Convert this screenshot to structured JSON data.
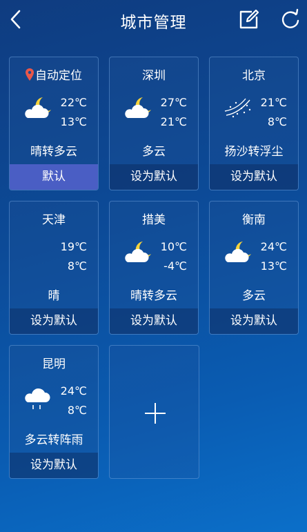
{
  "header": {
    "title": "城市管理"
  },
  "cities": [
    {
      "name": "自动定位",
      "hi": "22℃",
      "lo": "13℃",
      "desc": "晴转多云",
      "icon": "cloudy-moon-icon",
      "button": "默认",
      "is_default": true,
      "located": true
    },
    {
      "name": "深圳",
      "hi": "27℃",
      "lo": "21℃",
      "desc": "多云",
      "icon": "cloudy-moon-icon",
      "button": "设为默认",
      "is_default": false
    },
    {
      "name": "北京",
      "hi": "21℃",
      "lo": "8℃",
      "desc": "扬沙转浮尘",
      "icon": "sand-wind-icon",
      "button": "设为默认",
      "is_default": false
    },
    {
      "name": "天津",
      "hi": "19℃",
      "lo": "8℃",
      "desc": "晴",
      "icon": "moon-icon",
      "button": "设为默认",
      "is_default": false
    },
    {
      "name": "措美",
      "hi": "10℃",
      "lo": "-4℃",
      "desc": "晴转多云",
      "icon": "cloudy-moon-icon",
      "button": "设为默认",
      "is_default": false
    },
    {
      "name": "衡南",
      "hi": "24℃",
      "lo": "13℃",
      "desc": "多云",
      "icon": "cloudy-moon-icon",
      "button": "设为默认",
      "is_default": false
    },
    {
      "name": "昆明",
      "hi": "24℃",
      "lo": "8℃",
      "desc": "多云转阵雨",
      "icon": "rain-cloud-icon",
      "button": "设为默认",
      "is_default": false
    }
  ],
  "colors": {
    "active_button": "#4a5ec4",
    "pin": "#e8574a"
  }
}
